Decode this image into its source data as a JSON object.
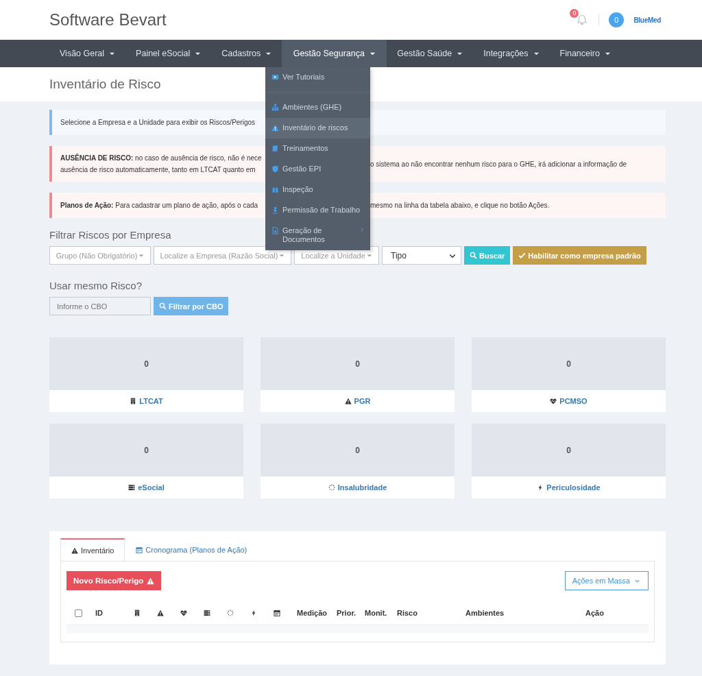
{
  "header": {
    "title": "Software Bevart",
    "notification_count": "0",
    "user_count": "0",
    "logo": "BlueMed"
  },
  "nav": [
    {
      "label": "Visão Geral",
      "selected": false
    },
    {
      "label": "Painel eSocial",
      "selected": false
    },
    {
      "label": "Cadastros",
      "selected": false
    },
    {
      "label": "Gestão Segurança",
      "selected": true
    },
    {
      "label": "Gestão Saúde",
      "selected": false
    },
    {
      "label": "Integrações",
      "selected": false
    },
    {
      "label": "Financeiro",
      "selected": false
    }
  ],
  "dropdown": {
    "sections": [
      [
        {
          "label": "Ver Tutoriais",
          "selected": false,
          "submenu": false
        }
      ],
      [
        {
          "label": "Ambientes (GHE)",
          "selected": false,
          "submenu": false
        },
        {
          "label": "Inventário de riscos",
          "selected": true,
          "submenu": false
        },
        {
          "label": "Treinamentos",
          "selected": false,
          "submenu": false
        },
        {
          "label": "Gestão EPI",
          "selected": false,
          "submenu": false
        },
        {
          "label": "Inspeção",
          "selected": false,
          "submenu": false
        },
        {
          "label": "Permissão de Trabalho",
          "selected": false,
          "submenu": false
        },
        {
          "label": "Geração de Documentos",
          "selected": false,
          "submenu": true
        }
      ]
    ]
  },
  "page_title": "Inventário de Risco",
  "alerts": [
    {
      "kind": "info",
      "left": [
        "Selecione a Empresa e a Unidade para exibir os Riscos/Perigos"
      ]
    },
    {
      "kind": "danger",
      "left": [
        "**AUSÊNCIA DE RISCO:** no caso de ausência de risco, não é nece",
        "ausência de risco automaticamente, tanto em LTCAT quanto em"
      ],
      "right": [
        "o sistema ao não encontrar nenhum risco para o GHE, irá adicionar a informação de"
      ]
    },
    {
      "kind": "danger",
      "left": [
        "**Planos de Ação:** Para cadastrar um plano de ação, após o cada"
      ],
      "right": [
        "mesmo na linha da tabela abaixo, e clique no botão Ações."
      ]
    }
  ],
  "filter": {
    "heading": "Filtrar Riscos por Empresa",
    "selects": [
      {
        "placeholder": "Grupo (Não Obrigatório)"
      },
      {
        "placeholder": "Localize a Empresa (Razão Social)"
      },
      {
        "placeholder": "Localize a Unidade"
      }
    ],
    "type_select": "Tipo",
    "buttons": [
      {
        "label": "Buscar",
        "kind": "search"
      },
      {
        "label": "Habilitar como empresa padrão",
        "kind": "check"
      }
    ]
  },
  "cbo": {
    "heading": "Usar mesmo Risco?",
    "placeholder": "Informe o CBO",
    "button": "Filtrar por CBO"
  },
  "cards": [
    {
      "count": "0",
      "label": "LTCAT"
    },
    {
      "count": "0",
      "label": "PGR"
    },
    {
      "count": "0",
      "label": "PCMSO"
    },
    {
      "count": "0",
      "label": "eSocial"
    },
    {
      "count": "0",
      "label": "Insalubridade"
    },
    {
      "count": "0",
      "label": "Periculosidade"
    }
  ],
  "tabs": [
    {
      "label": "Inventário",
      "selected": true
    },
    {
      "label": "Cronograma (Planos de Ação)",
      "selected": false
    }
  ],
  "new_button": "Novo Risco/Perigo",
  "bulk_button": "Ações em Massa",
  "table": {
    "select_all_checked": false,
    "columns": [
      "ID",
      "Medição",
      "Prior.",
      "Monit.",
      "Risco",
      "Ambientes",
      "Ação"
    ]
  }
}
